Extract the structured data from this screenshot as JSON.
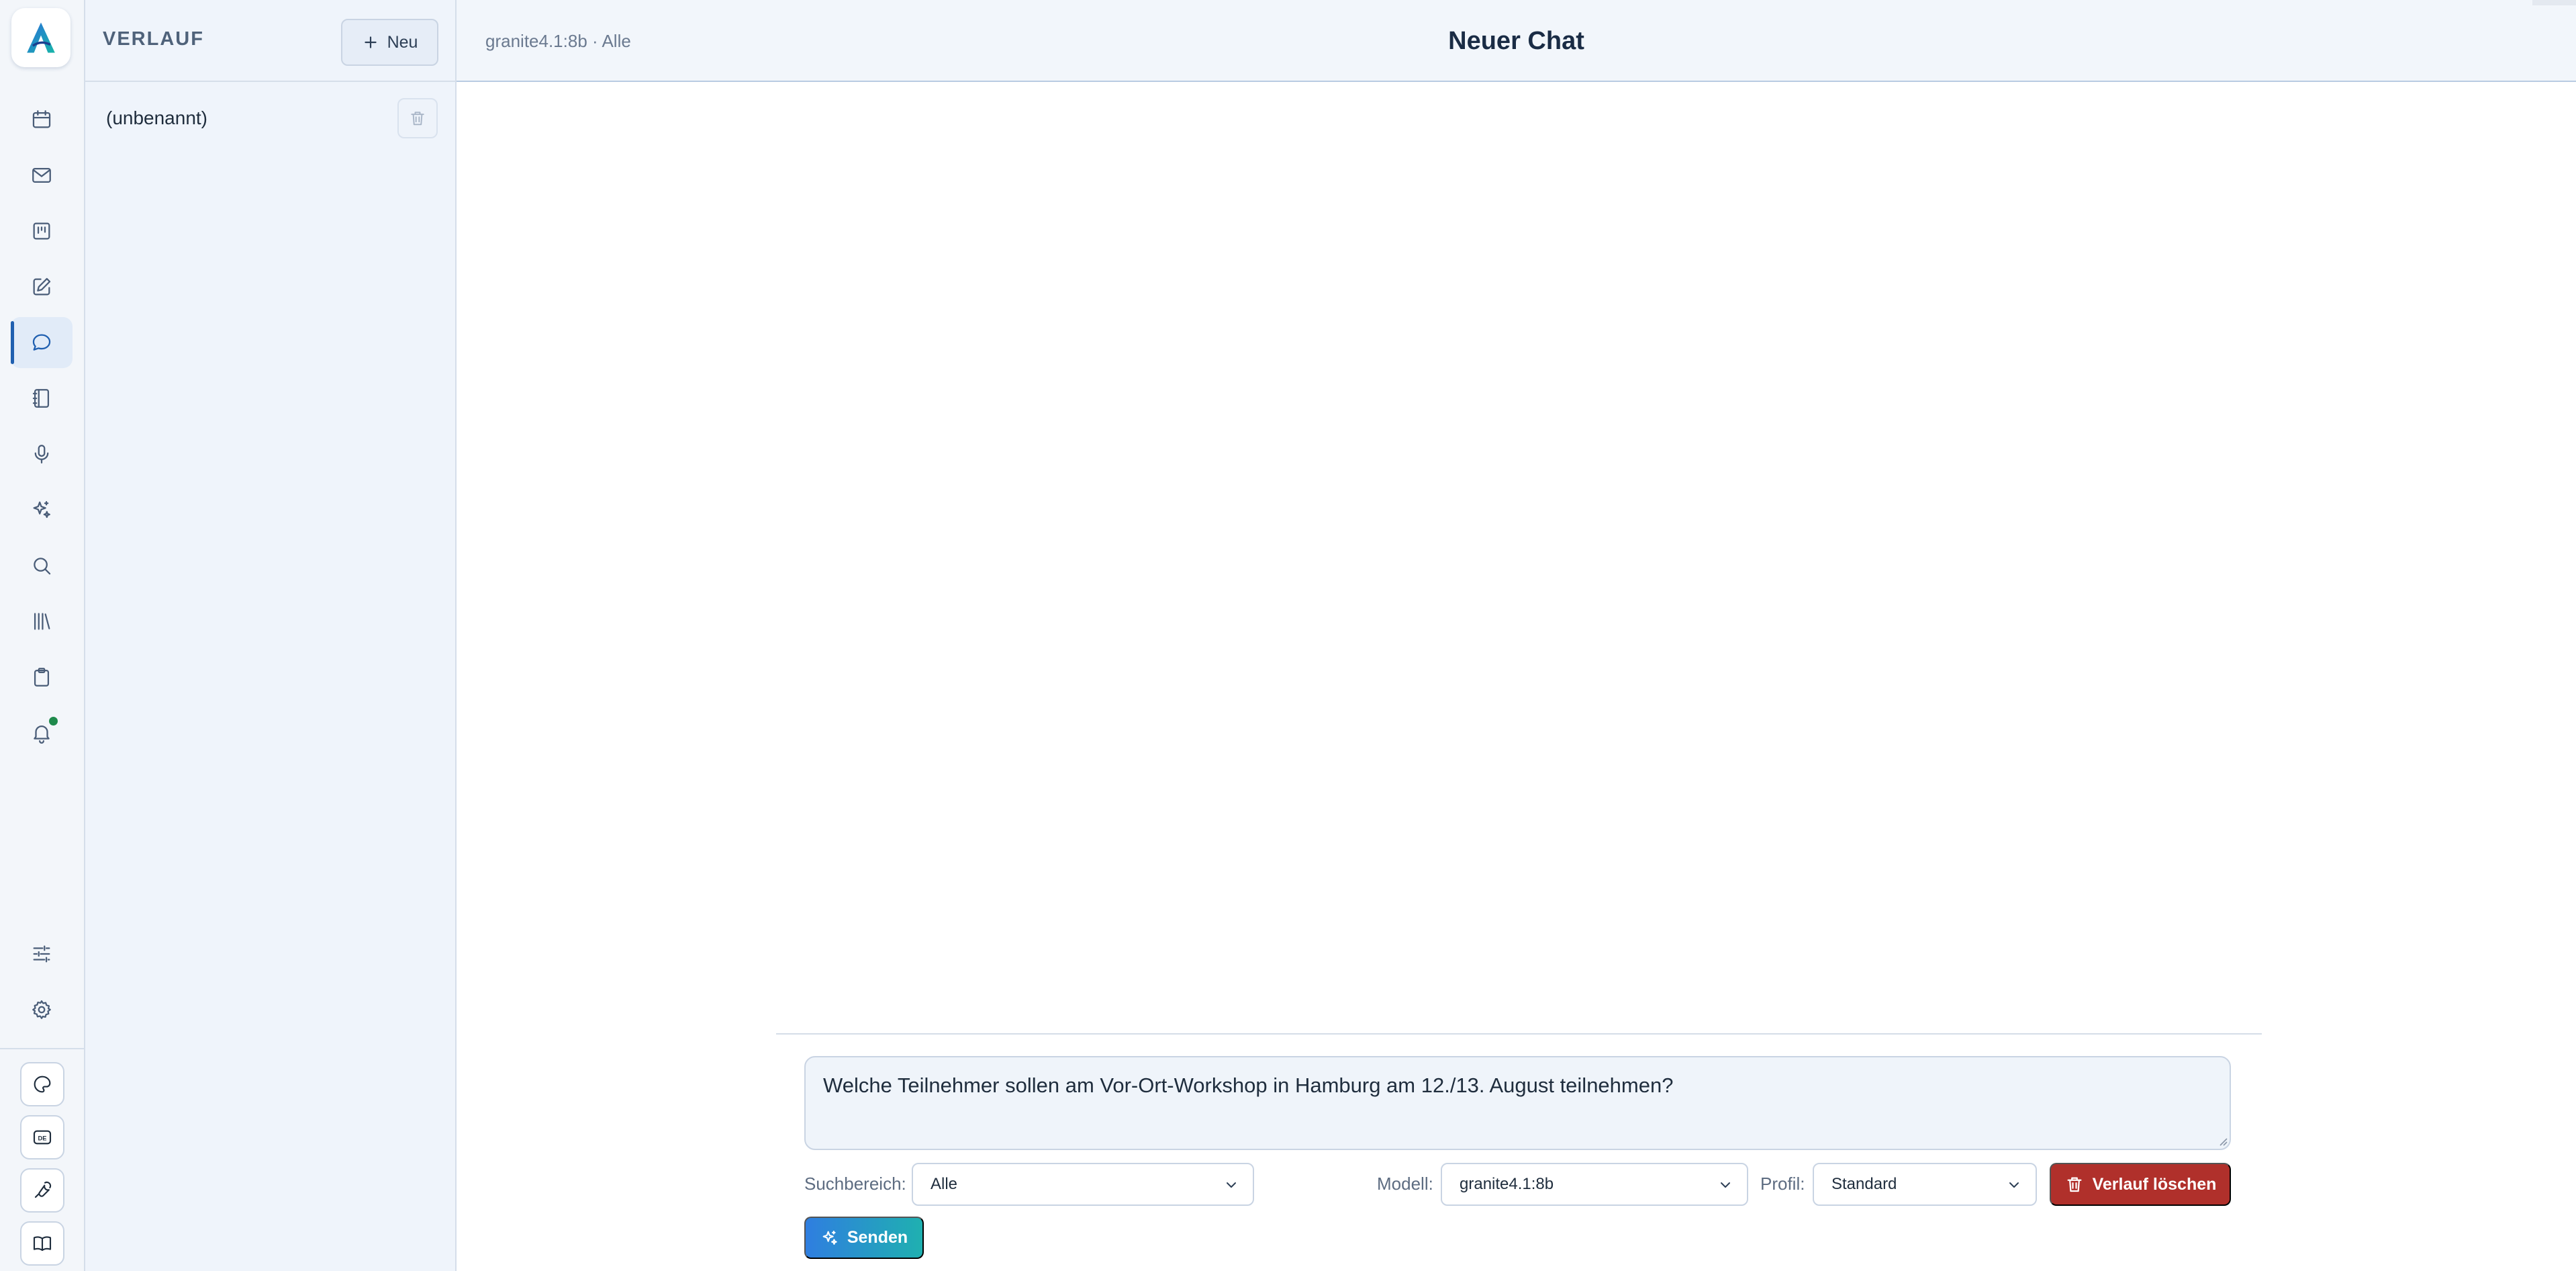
{
  "history": {
    "title": "VERLAUF",
    "new_label": "Neu",
    "items": [
      {
        "label": "(unbenannt)"
      }
    ]
  },
  "header": {
    "model_info": "granite4.1:8b · Alle",
    "title": "Neuer Chat"
  },
  "composer": {
    "prompt": "Welche Teilnehmer sollen am Vor-Ort-Workshop in Hamburg am 12./13. August teilnehmen?",
    "search_scope": {
      "label": "Suchbereich:",
      "value": "Alle"
    },
    "model": {
      "label": "Modell:",
      "value": "granite4.1:8b"
    },
    "profile": {
      "label": "Profil:",
      "value": "Standard"
    },
    "clear_label": "Verlauf löschen",
    "send_label": "Senden"
  },
  "rail": {
    "active": "chat",
    "icons": [
      "calendar-icon",
      "mail-icon",
      "kanban-icon",
      "edit-icon",
      "chat-icon",
      "notebook-icon",
      "microphone-icon",
      "sparkles-icon",
      "search-icon",
      "library-icon",
      "clipboard-icon",
      "bell-icon",
      "sliders-icon",
      "gear-icon"
    ],
    "tools": [
      "palette-icon",
      "language-de-icon",
      "wrench-icon",
      "book-icon"
    ],
    "tool_badge": "DE",
    "accent": "#1f5fb0",
    "notification_color": "#1f8a4c"
  },
  "colors": {
    "danger": "#b0302b",
    "send_gradient_start": "#2f7ee0",
    "send_gradient_end": "#1fb0b0"
  }
}
